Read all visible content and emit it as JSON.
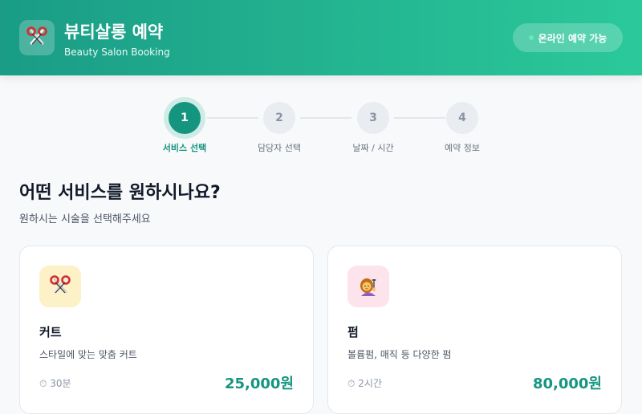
{
  "header": {
    "title": "뷰티살롱 예약",
    "subtitle": "Beauty Salon Booking",
    "logo_icon": "scissors-icon",
    "status_label": "온라인 예약 가능"
  },
  "stepper": {
    "steps": [
      {
        "number": "1",
        "label": "서비스 선택",
        "active": true
      },
      {
        "number": "2",
        "label": "담당자 선택",
        "active": false
      },
      {
        "number": "3",
        "label": "날짜 / 시간",
        "active": false
      },
      {
        "number": "4",
        "label": "예약 정보",
        "active": false
      }
    ]
  },
  "main": {
    "title": "어떤 서비스를 원하시나요?",
    "subtitle": "원하시는 시술을 선택해주세요"
  },
  "services": [
    {
      "icon": "scissors-icon",
      "name": "커트",
      "description": "스타일에 맞는 맞춤 커트",
      "duration": "30분",
      "price": "25,000원",
      "icon_bg": "#fdf1c7"
    },
    {
      "icon": "hairdresser-icon",
      "name": "펌",
      "description": "볼륨펌, 매직 등 다양한 펌",
      "duration": "2시간",
      "price": "80,000원",
      "icon_bg": "#fde4ec"
    }
  ],
  "theme": {
    "accent": "#15957f",
    "header_gradient": [
      "#1a9c86",
      "#2bc99a"
    ]
  }
}
